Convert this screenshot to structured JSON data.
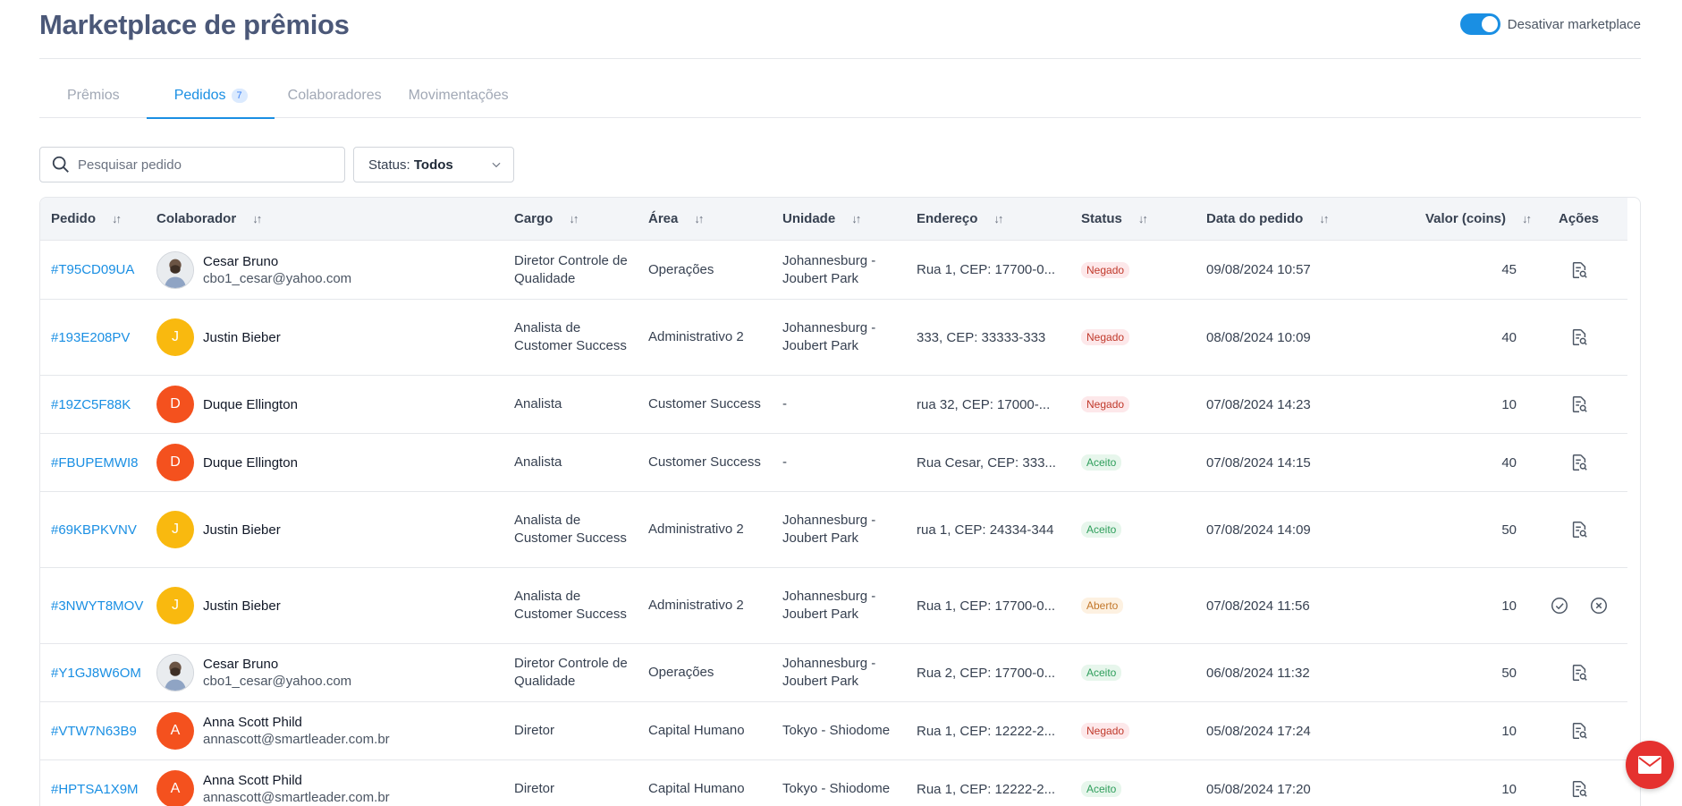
{
  "header": {
    "title": "Marketplace de prêmios",
    "toggle_label": "Desativar marketplace",
    "toggle_on": true
  },
  "tabs": [
    {
      "label": "Prêmios",
      "active": false
    },
    {
      "label": "Pedidos",
      "badge": "7",
      "active": true
    },
    {
      "label": "Colaboradores",
      "active": false
    },
    {
      "label": "Movimentações",
      "active": false
    }
  ],
  "filters": {
    "search_placeholder": "Pesquisar pedido",
    "status_label": "Status:",
    "status_value": "Todos"
  },
  "table": {
    "columns": [
      "Pedido",
      "Colaborador",
      "Cargo",
      "Área",
      "Unidade",
      "Endereço",
      "Status",
      "Data do pedido",
      "Valor (coins)",
      "Ações"
    ],
    "rows": [
      {
        "pedido": "#T95CD09UA",
        "nome": "Cesar Bruno",
        "email": "cbo1_cesar@yahoo.com",
        "avatar": "photo",
        "cargo": "Diretor Controle de Qualidade",
        "area": "Operações",
        "unidade": "Johannesburg - Joubert Park",
        "endereco": "Rua 1, CEP: 17700-0...",
        "status": "Negado",
        "data": "09/08/2024 10:57",
        "valor": "45"
      },
      {
        "pedido": "#193E208PV",
        "nome": "Justin Bieber",
        "email": "",
        "avatar": "J",
        "cargo": "Analista de Customer Success",
        "area": "Administrativo 2",
        "unidade": "Johannesburg - Joubert Park",
        "endereco": "333, CEP: 33333-333",
        "status": "Negado",
        "data": "08/08/2024 10:09",
        "valor": "40"
      },
      {
        "pedido": "#19ZC5F88K",
        "nome": "Duque Ellington",
        "email": "",
        "avatar": "D",
        "cargo": "Analista",
        "area": "Customer Success",
        "unidade": "-",
        "endereco": "rua 32, CEP: 17000-...",
        "status": "Negado",
        "data": "07/08/2024 14:23",
        "valor": "10"
      },
      {
        "pedido": "#FBUPEMWI8",
        "nome": "Duque Ellington",
        "email": "",
        "avatar": "D",
        "cargo": "Analista",
        "area": "Customer Success",
        "unidade": "-",
        "endereco": "Rua Cesar, CEP: 333...",
        "status": "Aceito",
        "data": "07/08/2024 14:15",
        "valor": "40"
      },
      {
        "pedido": "#69KBPKVNV",
        "nome": "Justin Bieber",
        "email": "",
        "avatar": "J",
        "cargo": "Analista de Customer Success",
        "area": "Administrativo 2",
        "unidade": "Johannesburg - Joubert Park",
        "endereco": "rua 1, CEP: 24334-344",
        "status": "Aceito",
        "data": "07/08/2024 14:09",
        "valor": "50"
      },
      {
        "pedido": "#3NWYT8MOV",
        "nome": "Justin Bieber",
        "email": "",
        "avatar": "J",
        "cargo": "Analista de Customer Success",
        "area": "Administrativo 2",
        "unidade": "Johannesburg - Joubert Park",
        "endereco": "Rua 1, CEP: 17700-0...",
        "status": "Aberto",
        "data": "07/08/2024 11:56",
        "valor": "10"
      },
      {
        "pedido": "#Y1GJ8W6OM",
        "nome": "Cesar Bruno",
        "email": "cbo1_cesar@yahoo.com",
        "avatar": "photo",
        "cargo": "Diretor Controle de Qualidade",
        "area": "Operações",
        "unidade": "Johannesburg - Joubert Park",
        "endereco": "Rua 2, CEP: 17700-0...",
        "status": "Aceito",
        "data": "06/08/2024 11:32",
        "valor": "50"
      },
      {
        "pedido": "#VTW7N63B9",
        "nome": "Anna Scott Phild",
        "email": "annascott@smartleader.com.br",
        "avatar": "A",
        "cargo": "Diretor",
        "area": "Capital Humano",
        "unidade": "Tokyo - Shiodome",
        "endereco": "Rua 1, CEP: 12222-2...",
        "status": "Negado",
        "data": "05/08/2024 17:24",
        "valor": "10"
      },
      {
        "pedido": "#HPTSA1X9M",
        "nome": "Anna Scott Phild",
        "email": "annascott@smartleader.com.br",
        "avatar": "A",
        "cargo": "Diretor",
        "area": "Capital Humano",
        "unidade": "Tokyo - Shiodome",
        "endereco": "Rua 1, CEP: 12222-2...",
        "status": "Aceito",
        "data": "05/08/2024 17:20",
        "valor": "10"
      }
    ]
  },
  "colors": {
    "accent": "#1a8fe3",
    "avatar_J": "#f9b90f",
    "avatar_D": "#f4511e",
    "avatar_A": "#f4511e",
    "fab": "#e5312f"
  }
}
